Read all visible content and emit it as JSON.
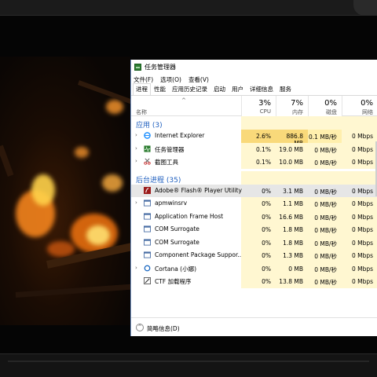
{
  "window": {
    "title": "任务管理器"
  },
  "menu": [
    "文件(F)",
    "选项(O)",
    "查看(V)"
  ],
  "tabs": [
    "进程",
    "性能",
    "应用历史记录",
    "启动",
    "用户",
    "详细信息",
    "服务"
  ],
  "active_tab": "进程",
  "columns": {
    "name": {
      "label": "名称"
    },
    "cpu": {
      "pct": "3%",
      "label": "CPU"
    },
    "memory": {
      "pct": "7%",
      "label": "内存"
    },
    "disk": {
      "pct": "0%",
      "label": "磁盘"
    },
    "network": {
      "pct": "0%",
      "label": "网络"
    }
  },
  "groups": {
    "apps": "应用 (3)",
    "background": "后台进程 (35)"
  },
  "apps": [
    {
      "name": "Internet Explorer",
      "cpu": "2.6%",
      "mem": "886.8 MB",
      "disk": "0.1 MB/秒",
      "net": "0 Mbps",
      "icon": "ie-icon",
      "expandable": true
    },
    {
      "name": "任务管理器",
      "cpu": "0.1%",
      "mem": "19.0 MB",
      "disk": "0 MB/秒",
      "net": "0 Mbps",
      "icon": "task-manager-icon",
      "expandable": true
    },
    {
      "name": "截图工具",
      "cpu": "0.1%",
      "mem": "10.0 MB",
      "disk": "0 MB/秒",
      "net": "0 Mbps",
      "icon": "scissors-icon",
      "expandable": true
    }
  ],
  "background": [
    {
      "name": "Adobe® Flash® Player Utility",
      "cpu": "0%",
      "mem": "3.1 MB",
      "disk": "0 MB/秒",
      "net": "0 Mbps",
      "icon": "flash-icon",
      "expandable": false,
      "selected": true
    },
    {
      "name": "apmwinsrv",
      "cpu": "0%",
      "mem": "1.1 MB",
      "disk": "0 MB/秒",
      "net": "0 Mbps",
      "icon": "service-icon",
      "expandable": true
    },
    {
      "name": "Application Frame Host",
      "cpu": "0%",
      "mem": "16.6 MB",
      "disk": "0 MB/秒",
      "net": "0 Mbps",
      "icon": "window-icon",
      "expandable": false
    },
    {
      "name": "COM Surrogate",
      "cpu": "0%",
      "mem": "1.8 MB",
      "disk": "0 MB/秒",
      "net": "0 Mbps",
      "icon": "window-icon",
      "expandable": false
    },
    {
      "name": "COM Surrogate",
      "cpu": "0%",
      "mem": "1.8 MB",
      "disk": "0 MB/秒",
      "net": "0 Mbps",
      "icon": "window-icon",
      "expandable": false
    },
    {
      "name": "Component Package Suppor...",
      "cpu": "0%",
      "mem": "1.3 MB",
      "disk": "0 MB/秒",
      "net": "0 Mbps",
      "icon": "window-icon",
      "expandable": false
    },
    {
      "name": "Cortana (小娜)",
      "cpu": "0%",
      "mem": "0 MB",
      "disk": "0 MB/秒",
      "net": "0 Mbps",
      "icon": "cortana-icon",
      "expandable": true
    },
    {
      "name": "CTF 加载程序",
      "cpu": "0%",
      "mem": "13.8 MB",
      "disk": "0 MB/秒",
      "net": "0 Mbps",
      "icon": "ctf-icon",
      "expandable": false
    }
  ],
  "footer": {
    "label": "简略信息(D)"
  },
  "colors": {
    "heat_light": "#fff7d1",
    "heat_mid": "#ffefad",
    "heat_strong": "#f9d97a",
    "group_text": "#1f5fbf",
    "selected_row": "#e6e6e6"
  }
}
